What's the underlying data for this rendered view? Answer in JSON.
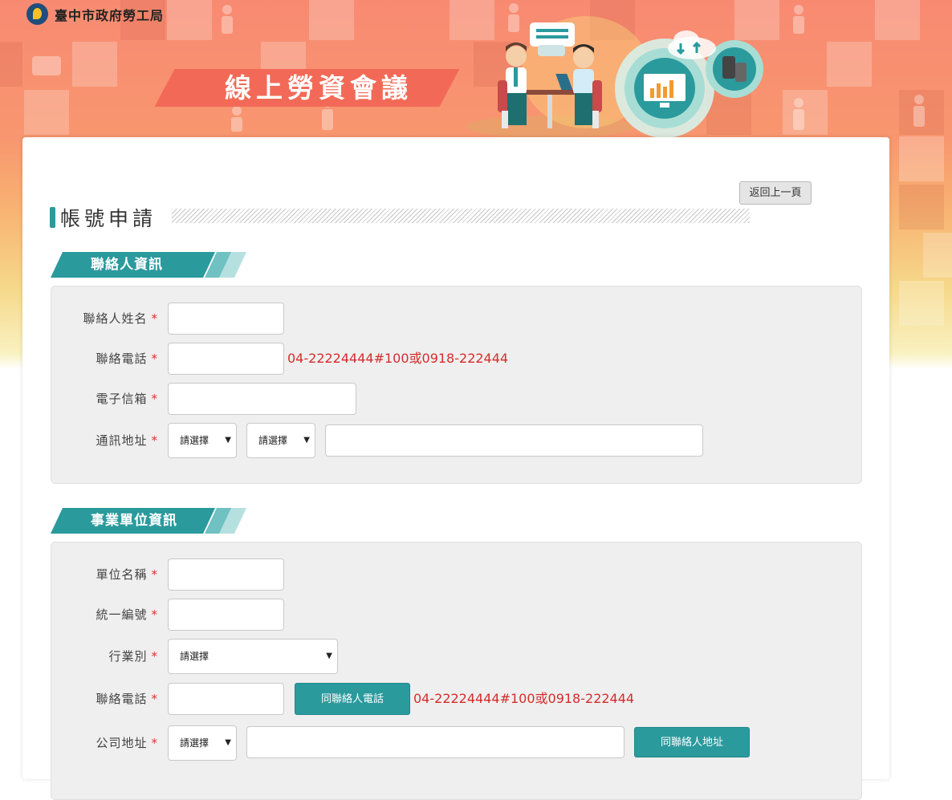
{
  "header": {
    "org_name": "臺中市政府勞工局",
    "banner_title": "線上勞資會議"
  },
  "page": {
    "heading": "帳號申請",
    "back_label": "返回上一頁"
  },
  "contact_section": {
    "title": "聯絡人資訊",
    "name_label": "聯絡人姓名",
    "phone_label": "聯絡電話",
    "phone_hint": "04-22224444#100或0918-222444",
    "email_label": "電子信箱",
    "address_label": "通訊地址",
    "city_select": "請選擇",
    "district_select": "請選擇",
    "required_mark": "*"
  },
  "business_section": {
    "title": "事業單位資訊",
    "unit_name_label": "單位名稱",
    "tax_id_label": "統一編號",
    "industry_label": "行業別",
    "industry_select": "請選擇",
    "phone_label": "聯絡電話",
    "same_phone_button": "同聯絡人電話",
    "phone_hint": "04-22224444#100或0918-222444",
    "address_label": "公司地址",
    "city_select": "請選擇",
    "same_address_button": "同聯絡人地址",
    "required_mark": "*"
  },
  "colors": {
    "accent": "#2a9a9d",
    "banner": "#f88a72",
    "ribbon": "#f26a57",
    "hint": "#d62b2b"
  },
  "icons": [
    "logo-icon",
    "chat-bubble-icon",
    "monitor-chart-icon",
    "mobile-devices-icon",
    "cloud-sync-icon"
  ]
}
